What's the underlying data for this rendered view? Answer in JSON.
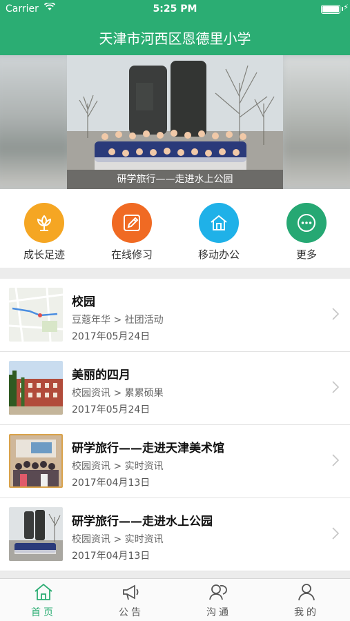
{
  "status_bar": {
    "carrier": "Carrier",
    "time": "5:25 PM",
    "battery_level": 1.0
  },
  "nav": {
    "title": "天津市河西区恩德里小学"
  },
  "banner": {
    "caption": "研学旅行——走进水上公园"
  },
  "quick_actions": [
    {
      "label": "成长足迹",
      "icon": "flower-icon",
      "color": "#f5a623"
    },
    {
      "label": "在线修习",
      "icon": "pencil-icon",
      "color": "#f06a23"
    },
    {
      "label": "移动办公",
      "icon": "home-icon",
      "color": "#1fb1e8"
    },
    {
      "label": "更多",
      "icon": "more-icon",
      "color": "#26a873"
    }
  ],
  "list": [
    {
      "title": "校园",
      "path": "豆蔻年华 > 社团活动",
      "date": "2017年05月24日",
      "thumb": "map-thumbnail"
    },
    {
      "title": "美丽的四月",
      "path": "校园资讯 > 累累硕果",
      "date": "2017年05月24日",
      "thumb": "building-thumbnail"
    },
    {
      "title": "研学旅行——走进天津美术馆",
      "path": "校园资讯 > 实时资讯",
      "date": "2017年04月13日",
      "thumb": "group-photo-thumbnail"
    },
    {
      "title": "研学旅行——走进水上公园",
      "path": "校园资讯 > 实时资讯",
      "date": "2017年04月13日",
      "thumb": "park-photo-thumbnail"
    }
  ],
  "tabs": [
    {
      "label": "首页",
      "icon": "home-outline-icon",
      "active": true
    },
    {
      "label": "公告",
      "icon": "megaphone-icon",
      "active": false
    },
    {
      "label": "沟通",
      "icon": "chat-people-icon",
      "active": false
    },
    {
      "label": "我的",
      "icon": "person-icon",
      "active": false
    }
  ],
  "colors": {
    "brand": "#2bad73",
    "active_tab": "#2bad73"
  }
}
